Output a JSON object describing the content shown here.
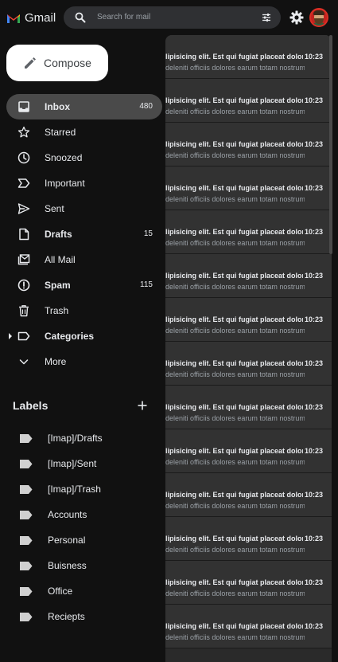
{
  "app": {
    "name": "Gmail"
  },
  "search": {
    "placeholder": "Search for mail"
  },
  "compose": {
    "label": "Compose"
  },
  "nav": [
    {
      "label": "Inbox",
      "count": "480",
      "icon": "inbox-icon",
      "bold": true,
      "active": true
    },
    {
      "label": "Starred",
      "count": "",
      "icon": "star-icon"
    },
    {
      "label": "Snoozed",
      "count": "",
      "icon": "clock-icon"
    },
    {
      "label": "Important",
      "count": "",
      "icon": "important-icon"
    },
    {
      "label": "Sent",
      "count": "",
      "icon": "send-icon"
    },
    {
      "label": "Drafts",
      "count": "15",
      "icon": "draft-icon",
      "bold": true
    },
    {
      "label": "All Mail",
      "count": "",
      "icon": "all-mail-icon"
    },
    {
      "label": "Spam",
      "count": "115",
      "icon": "spam-icon",
      "bold": true
    },
    {
      "label": "Trash",
      "count": "",
      "icon": "trash-icon"
    },
    {
      "label": "Categories",
      "count": "",
      "icon": "label-icon",
      "bold": true
    },
    {
      "label": "More",
      "count": "",
      "icon": "chevron-down-icon"
    }
  ],
  "labels": {
    "heading": "Labels",
    "items": [
      "[Imap]/Drafts",
      "[Imap]/Sent",
      "[Imap]/Trash",
      "Accounts",
      "Personal",
      "Buisness",
      "Office",
      "Reciepts"
    ]
  },
  "emails": [
    {
      "subject": "lipisicing elit. Est qui fugiat placeat dolor",
      "time": "10:23",
      "snippet": "deleniti officiis dolores earum totam nostrum"
    },
    {
      "subject": "lipisicing elit. Est qui fugiat placeat dolor",
      "time": "10:23",
      "snippet": "deleniti officiis dolores earum totam nostrum"
    },
    {
      "subject": "lipisicing elit. Est qui fugiat placeat dolor",
      "time": "10:23",
      "snippet": "deleniti officiis dolores earum totam nostrum"
    },
    {
      "subject": "lipisicing elit. Est qui fugiat placeat dolor",
      "time": "10:23",
      "snippet": "deleniti officiis dolores earum totam nostrum"
    },
    {
      "subject": "lipisicing elit. Est qui fugiat placeat dolor",
      "time": "10:23",
      "snippet": "deleniti officiis dolores earum totam nostrum"
    },
    {
      "subject": "lipisicing elit. Est qui fugiat placeat dolor",
      "time": "10:23",
      "snippet": "deleniti officiis dolores earum totam nostrum"
    },
    {
      "subject": "lipisicing elit. Est qui fugiat placeat dolor",
      "time": "10:23",
      "snippet": "deleniti officiis dolores earum totam nostrum"
    },
    {
      "subject": "lipisicing elit. Est qui fugiat placeat dolor",
      "time": "10:23",
      "snippet": "deleniti officiis dolores earum totam nostrum"
    },
    {
      "subject": "lipisicing elit. Est qui fugiat placeat dolor",
      "time": "10:23",
      "snippet": "deleniti officiis dolores earum totam nostrum"
    },
    {
      "subject": "lipisicing elit. Est qui fugiat placeat dolor",
      "time": "10:23",
      "snippet": "deleniti officiis dolores earum totam nostrum"
    },
    {
      "subject": "lipisicing elit. Est qui fugiat placeat dolor",
      "time": "10:23",
      "snippet": "deleniti officiis dolores earum totam nostrum"
    },
    {
      "subject": "lipisicing elit. Est qui fugiat placeat dolor",
      "time": "10:23",
      "snippet": "deleniti officiis dolores earum totam nostrum"
    },
    {
      "subject": "lipisicing elit. Est qui fugiat placeat dolor",
      "time": "10:23",
      "snippet": "deleniti officiis dolores earum totam nostrum"
    },
    {
      "subject": "lipisicing elit. Est qui fugiat placeat dolor",
      "time": "10:23",
      "snippet": "deleniti officiis dolores earum totam nostrum"
    }
  ],
  "colors": {
    "background": "#111111",
    "active_item": "#4a4a4a",
    "compose_bg": "#ffffff",
    "mail_row": "#323232"
  }
}
